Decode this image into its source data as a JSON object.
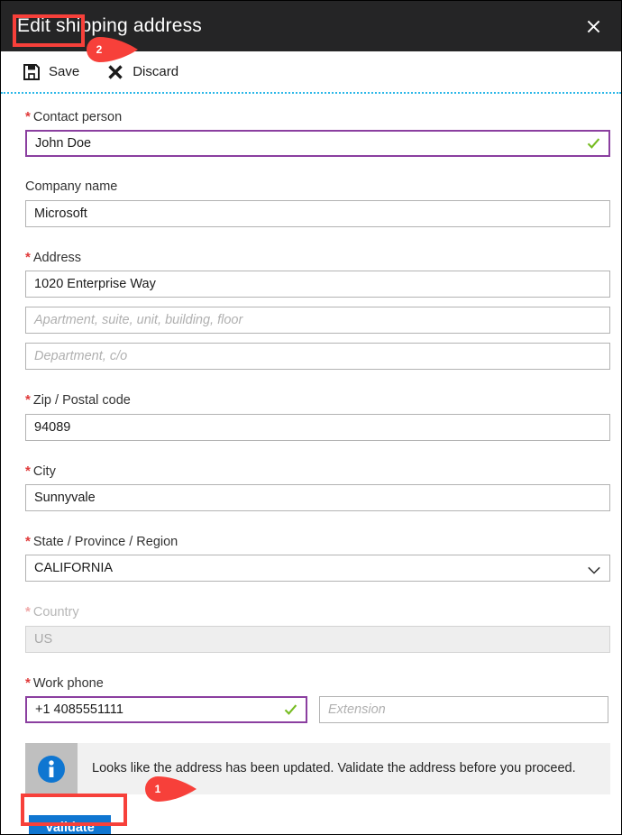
{
  "window": {
    "title": "Edit shipping address",
    "close_label": "✕",
    "close_icon": "close-icon"
  },
  "toolbar": {
    "save_label": "Save",
    "save_icon": "save-floppy-disk-icon",
    "discard_label": "Discard",
    "discard_icon": "discard-x-icon"
  },
  "callouts": [
    {
      "number": "1",
      "target": "validate-button"
    },
    {
      "number": "2",
      "target": "save-button"
    }
  ],
  "form": {
    "contact_person": {
      "label": "Contact person",
      "required": true,
      "value": "John Doe",
      "placeholder": "",
      "state": "valid",
      "valid_icon": "check-icon"
    },
    "company_name": {
      "label": "Company name",
      "required": false,
      "value": "Microsoft",
      "placeholder": "",
      "state": "normal"
    },
    "address": {
      "label": "Address",
      "required": true,
      "value": "1020 Enterprise Way",
      "placeholder": "",
      "state": "normal"
    },
    "address_line2": {
      "label": "",
      "required": false,
      "value": "",
      "placeholder": "Apartment, suite, unit, building, floor",
      "state": "normal"
    },
    "address_line3": {
      "label": "",
      "required": false,
      "value": "",
      "placeholder": "Department, c/o",
      "state": "normal"
    },
    "zip": {
      "label": "Zip / Postal code",
      "required": true,
      "value": "94089",
      "placeholder": "",
      "state": "normal"
    },
    "city": {
      "label": "City",
      "required": true,
      "value": "Sunnyvale",
      "placeholder": "",
      "state": "normal"
    },
    "state_province": {
      "label": "State / Province / Region",
      "required": true,
      "value": "CALIFORNIA",
      "placeholder": "",
      "state": "select",
      "chevron_icon": "chevron-down-icon"
    },
    "country": {
      "label": "Country",
      "required": true,
      "value": "US",
      "placeholder": "",
      "state": "disabled"
    },
    "work_phone": {
      "label": "Work phone",
      "required": true,
      "value": "+1 4085551111",
      "placeholder": "",
      "state": "valid",
      "valid_icon": "check-icon"
    },
    "extension": {
      "label": "",
      "required": false,
      "value": "",
      "placeholder": "Extension",
      "state": "normal"
    }
  },
  "banner": {
    "icon": "info-icon",
    "message": "Looks like the address has been updated. Validate the address before you proceed."
  },
  "actions": {
    "validate_label": "Validate"
  },
  "colors": {
    "titlebar_bg": "#252526",
    "highlight_red": "#f7403a",
    "callout_red": "#f7403a",
    "valid_border_purple": "#8b3fa0",
    "check_green": "#76bc21",
    "required_red": "#e03a3a",
    "primary_blue": "#0f76d1",
    "info_blue": "#0f76d1",
    "dotted_rule_blue": "#2bb7e8",
    "banner_bg": "#f1f1f1",
    "banner_icon_bg": "#bfbfbf",
    "disabled_bg": "#eeeeee"
  }
}
